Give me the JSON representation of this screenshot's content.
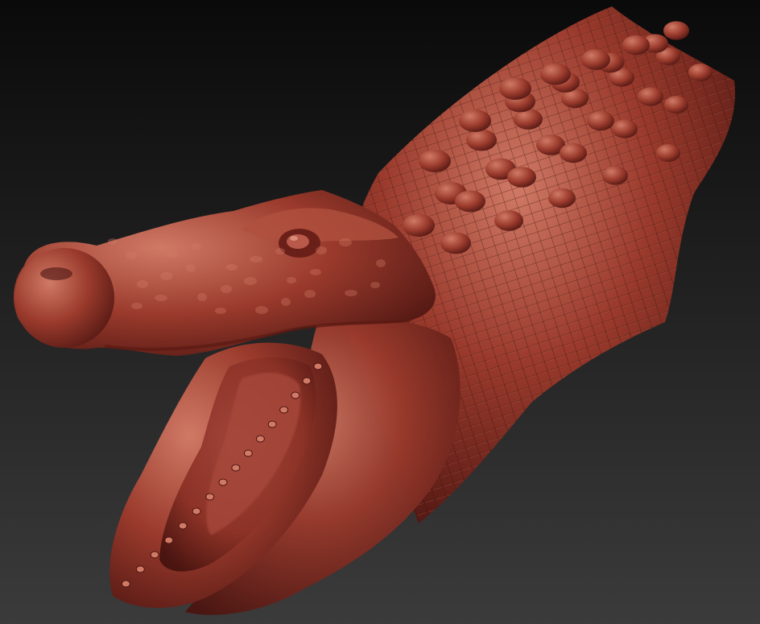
{
  "viewport": {
    "subject": "crocodile-head-sculpt",
    "colors": {
      "background_top": "#0a0a0a",
      "background_bottom": "#3b3b3b",
      "clay_base": "#9a3a2c",
      "clay_highlight": "#d07a66",
      "clay_shadow": "#4a1410",
      "mouth_interior": "#8c3226",
      "tongue": "#a2443a"
    }
  }
}
